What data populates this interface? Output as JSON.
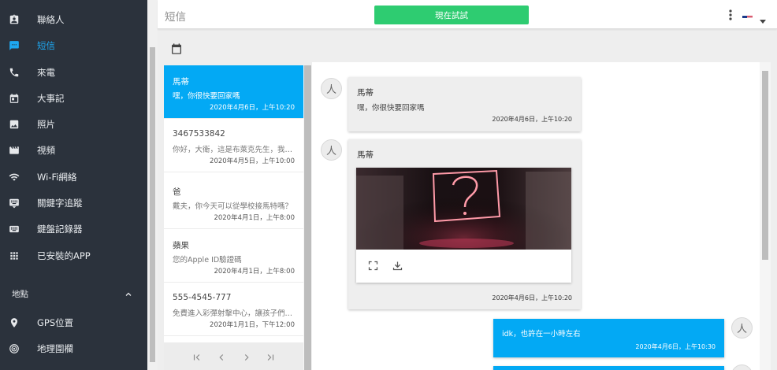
{
  "sidebar": {
    "items": [
      {
        "label": "聯絡人",
        "icon": "contacts-icon"
      },
      {
        "label": "短信",
        "icon": "message-icon",
        "active": true
      },
      {
        "label": "來電",
        "icon": "phone-icon"
      },
      {
        "label": "大事記",
        "icon": "calendar-event-icon"
      },
      {
        "label": "照片",
        "icon": "photo-icon"
      },
      {
        "label": "視頻",
        "icon": "video-icon"
      },
      {
        "label": "Wi-Fi網絡",
        "icon": "wifi-icon"
      },
      {
        "label": "關鍵字追蹤",
        "icon": "keyboard-icon"
      },
      {
        "label": "鍵盤記錄器",
        "icon": "keylogger-icon"
      },
      {
        "label": "已安裝的APP",
        "icon": "apps-icon"
      }
    ],
    "section_title": "地點",
    "location_items": [
      {
        "label": "GPS位置",
        "icon": "location-pin-icon"
      },
      {
        "label": "地理圍欄",
        "icon": "geofence-icon"
      }
    ]
  },
  "header": {
    "title": "短信",
    "try_button": "現在試試",
    "language_flag": "us-flag-icon"
  },
  "conversations": [
    {
      "name": "馬蒂",
      "preview": "嘿，你很快要回家嗎",
      "time": "2020年4月6日，上午10:20",
      "selected": true
    },
    {
      "name": "3467533842",
      "preview": "你好，大衛，這是布萊克先生，我注意到",
      "time": "2020年4月5日，上午10:00"
    },
    {
      "name": "爸",
      "preview": "戴夫，你今天可以從學校接馬特嗎？",
      "time": "2020年4月1日，上午8:00"
    },
    {
      "name": "蘋果",
      "preview": "您的Apple ID驗證碼",
      "time": "2020年4月1日，上午8:00"
    },
    {
      "name": "555-4545-777",
      "preview": "免費進入彩彈射擊中心，讓孩子們今天",
      "time": "2020年1月1日，下午12:00"
    }
  ],
  "messages": [
    {
      "sender": "馬蒂",
      "text": "嘿，你很快要回家嗎",
      "time": "2020年4月6日，上午10:20",
      "direction": "in"
    },
    {
      "sender": "馬蒂",
      "image": true,
      "time": "2020年4月6日，上午10:20",
      "direction": "in"
    },
    {
      "text": "idk，也許在一小時左右",
      "time": "2020年4月6日，上午10:30",
      "direction": "out"
    }
  ],
  "avatar_glyph": "人",
  "colors": {
    "sidebar_bg": "#2b323c",
    "accent": "#03a9f4",
    "active_nav": "#1ea7f0",
    "try_button": "#2ecc71"
  }
}
